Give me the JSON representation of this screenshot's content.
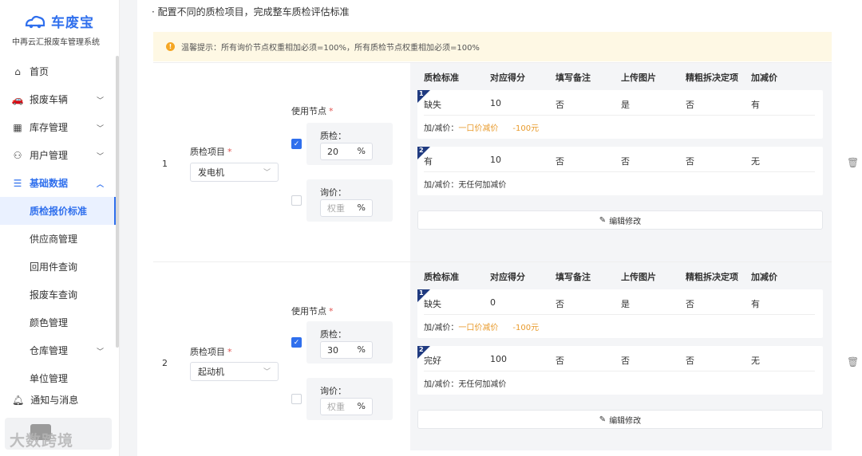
{
  "brand": {
    "name": "车废宝",
    "subtitle": "中再云汇报废车管理系统"
  },
  "nav": {
    "home": "首页",
    "vehicles": "报废车辆",
    "inventory": "库存管理",
    "users": "用户管理",
    "basic_data": "基础数据",
    "sub": [
      "质检报价标准",
      "供应商管理",
      "回用件查询",
      "报废车查询",
      "颜色管理",
      "仓库管理",
      "单位管理"
    ],
    "notifications": "通知与消息"
  },
  "watermark": "大数跨境",
  "page": {
    "description": "· 配置不同的质检项目，完成整车质检评估标准",
    "tip_label": "温馨提示：",
    "tip_text": "所有询价节点权重相加必须=100%，所有质检节点权重相加必须=100%"
  },
  "form_labels": {
    "item": "质检项目",
    "nodes": "使用节点",
    "inspection": "质检：",
    "inquiry": "询价：",
    "weight_placeholder": "权重",
    "percent": "%",
    "adjust_prefix": "加/减价：",
    "edit": "编辑修改"
  },
  "columns": [
    "质检标准",
    "对应得分",
    "填写备注",
    "上传图片",
    "精粗拆决定项",
    "加减价"
  ],
  "rows": [
    {
      "index": "1",
      "item": "发电机",
      "inspection_weight": "20",
      "inspection_checked": true,
      "inquiry_checked": false,
      "standards": [
        {
          "num": "1",
          "standard": "缺失",
          "score": "10",
          "remark": "否",
          "photo": "是",
          "decisive": "否",
          "adjust": "有",
          "adjust_detail": "一口价减价",
          "adjust_amount": "-100元"
        },
        {
          "num": "2",
          "standard": "有",
          "score": "10",
          "remark": "否",
          "photo": "否",
          "decisive": "否",
          "adjust": "无",
          "adjust_none": "无任何加减价"
        }
      ]
    },
    {
      "index": "2",
      "item": "起动机",
      "inspection_weight": "30",
      "inspection_checked": true,
      "inquiry_checked": false,
      "standards": [
        {
          "num": "1",
          "standard": "缺失",
          "score": "0",
          "remark": "否",
          "photo": "是",
          "decisive": "否",
          "adjust": "有",
          "adjust_detail": "一口价减价",
          "adjust_amount": "-100元"
        },
        {
          "num": "2",
          "standard": "完好",
          "score": "100",
          "remark": "否",
          "photo": "否",
          "decisive": "否",
          "adjust": "无",
          "adjust_none": "无任何加减价"
        }
      ]
    }
  ],
  "colors": {
    "primary": "#2f6fed",
    "tip_bg": "#fef8e4",
    "warn": "#f5a623",
    "badge": "#1f3a80",
    "orange": "#e89a2b"
  }
}
